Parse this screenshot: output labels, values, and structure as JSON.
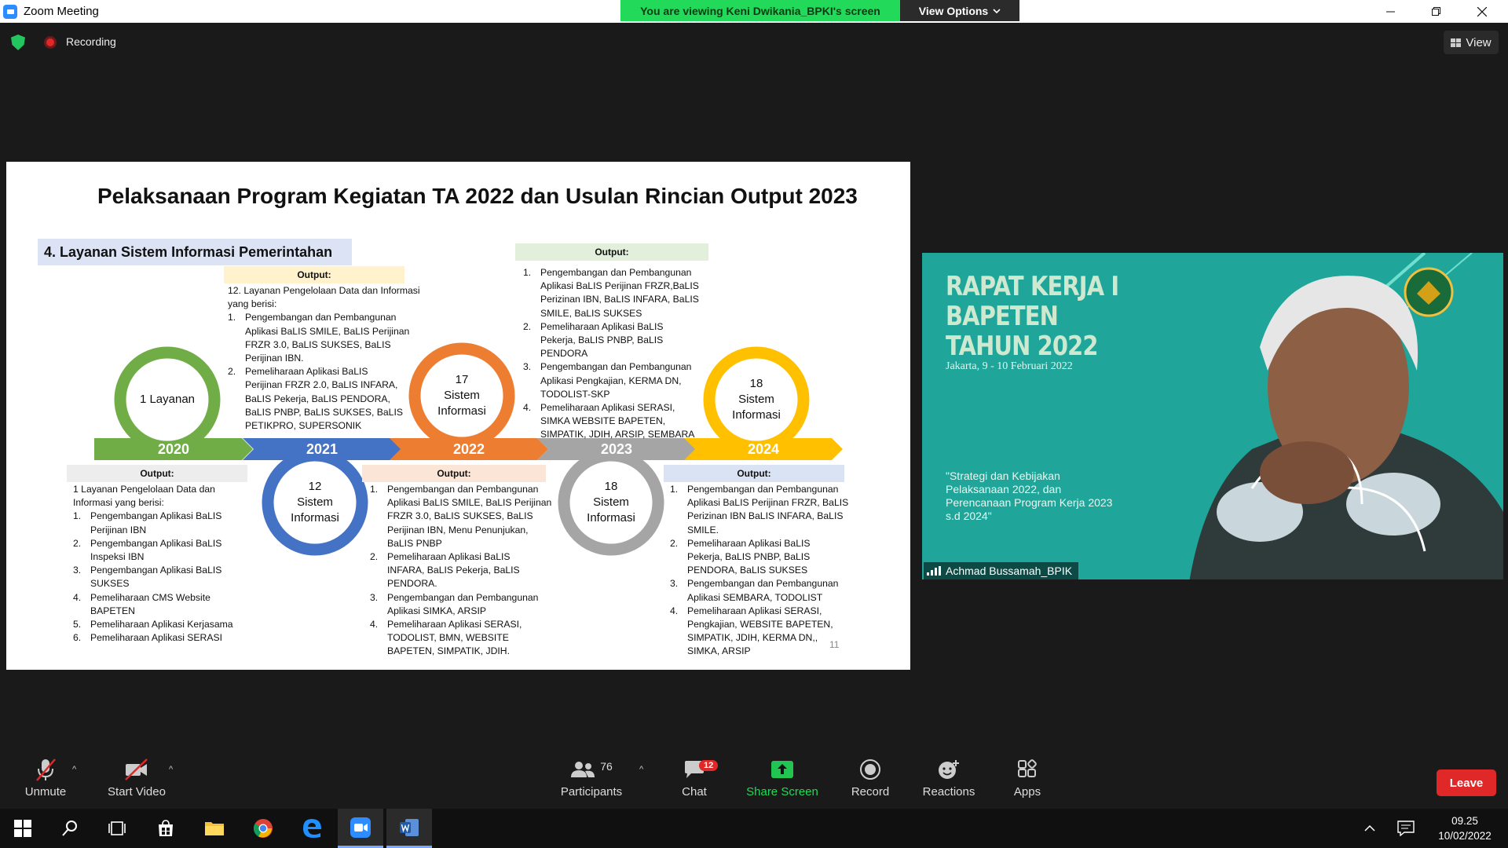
{
  "window": {
    "title": "Zoom Meeting",
    "viewing_banner": "You are viewing Keni Dwikania_BPKI's screen",
    "view_options": "View Options",
    "recording": "Recording",
    "view": "View"
  },
  "slide": {
    "title": "Pelaksanaan Program Kegiatan TA 2022 dan Usulan Rincian Output 2023",
    "section": "4. Layanan Sistem Informasi Pemerintahan",
    "page": "11",
    "years": [
      "2020",
      "2021",
      "2022",
      "2023",
      "2024"
    ],
    "rings": [
      [
        "1 Layanan"
      ],
      [
        "12",
        "Sistem",
        "Informasi"
      ],
      [
        "17",
        "Sistem",
        "Informasi"
      ],
      [
        "18",
        "Sistem",
        "Informasi"
      ],
      [
        "18",
        "Sistem",
        "Informasi"
      ]
    ],
    "output_label": "Output:",
    "out2020": {
      "intro": "1 Layanan Pengelolaan Data dan Informasi yang berisi:",
      "items": [
        [
          "Pengembangan Aplikasi BaLIS",
          "Perijinan IBN"
        ],
        [
          "Pengembangan Aplikasi BaLIS",
          "Inspeksi IBN"
        ],
        [
          "Pengembangan Aplikasi BaLIS",
          "SUKSES"
        ],
        [
          "Pemeliharaan CMS Website",
          "BAPETEN"
        ],
        [
          "Pemeliharaan Aplikasi Kerjasama"
        ],
        [
          "Pemeliharaan Aplikasi SERASI"
        ]
      ]
    },
    "out2021": {
      "intro": "12. Layanan Pengelolaan Data dan Informasi yang berisi:",
      "items": [
        [
          "Pengembangan dan Pembangunan",
          "Aplikasi BaLIS SMILE, BaLIS Perijinan",
          "FRZR 3.0, BaLIS SUKSES, BaLIS",
          "Perijinan IBN."
        ],
        [
          "Pemeliharaan  Aplikasi BaLIS",
          "Perijinan FRZR 2.0,  BaLIS INFARA,",
          "BaLIS Pekerja, BaLIS PENDORA,",
          "BaLIS PNBP, BaLIS SUKSES, BaLIS",
          "PETIKPRO, SUPERSONIK"
        ]
      ]
    },
    "out2022": {
      "items": [
        [
          "Pengembangan dan Pembangunan",
          "Aplikasi BaLIS SMILE, BaLIS Perijinan",
          "FRZR 3.0, BaLIS SUKSES, BaLIS",
          "Perijinan IBN, Menu Penunjukan,",
          "BaLIS PNBP"
        ],
        [
          "Pemeliharaan  Aplikasi BaLIS",
          "INFARA, BaLIS Pekerja, BaLIS",
          "PENDORA."
        ],
        [
          "Pengembangan dan Pembangunan",
          "Aplikasi SIMKA, ARSIP"
        ],
        [
          "Pemeliharaan Aplikasi SERASI,",
          "TODOLIST, BMN, WEBSITE",
          "BAPETEN, SIMPATIK, JDIH."
        ]
      ]
    },
    "out2023": {
      "items": [
        [
          "Pengembangan dan Pembangunan",
          "Aplikasi BaLIS Perijinan FRZR,BaLIS",
          "Perizinan IBN, BaLIS INFARA, BaLIS",
          "SMILE, BaLIS SUKSES"
        ],
        [
          "Pemeliharaan Aplikasi  BaLIS",
          "Pekerja, BaLIS PNBP, BaLIS",
          "PENDORA"
        ],
        [
          "Pengembangan dan Pembangunan",
          "Aplikasi Pengkajian, KERMA DN,",
          "TODOLIST-SKP"
        ],
        [
          "Pemeliharaan Aplikasi SERASI,",
          "SIMKA  WEBSITE BAPETEN,",
          "SIMPATIK, JDIH, ARSIP, SEMBARA"
        ]
      ]
    },
    "out2024": {
      "items": [
        [
          "Pengembangan dan Pembangunan",
          "Aplikasi BaLIS Perijinan FRZR, BaLIS",
          "Perizinan IBN  BaLIS INFARA, BaLIS",
          "SMILE."
        ],
        [
          "Pemeliharaan Aplikasi  BaLIS",
          "Pekerja, BaLIS PNBP, BaLIS",
          "PENDORA, BaLIS SUKSES"
        ],
        [
          "Pengembangan dan Pembangunan",
          "Aplikasi SEMBARA, TODOLIST"
        ],
        [
          "Pemeliharaan Aplikasi SERASI,",
          "Pengkajian, WEBSITE BAPETEN,",
          "SIMPATIK, JDIH, KERMA DN,,",
          "SIMKA, ARSIP"
        ]
      ]
    },
    "colors": {
      "green": "#70ad47",
      "blue": "#4472c4",
      "orange": "#ed7d31",
      "gray": "#a5a5a5",
      "yellow": "#ffc000"
    }
  },
  "video": {
    "title_lines": [
      "RAPAT KERJA I",
      "BAPETEN",
      "TAHUN 2022"
    ],
    "date": "Jakarta, 9 - 10 Februari 2022",
    "quote": "\"Strategi dan Kebijakan Pelaksanaan 2022, dan Perencanaan Program Kerja 2023 s.d 2024\"",
    "name": "Achmad Bussamah_BPIK"
  },
  "toolbar": {
    "unmute": "Unmute",
    "start_video": "Start Video",
    "participants": "Participants",
    "participants_count": "76",
    "chat": "Chat",
    "chat_badge": "12",
    "share_screen": "Share Screen",
    "record": "Record",
    "reactions": "Reactions",
    "apps": "Apps",
    "leave": "Leave"
  },
  "taskbar": {
    "time": "09.25",
    "date": "10/02/2022"
  }
}
